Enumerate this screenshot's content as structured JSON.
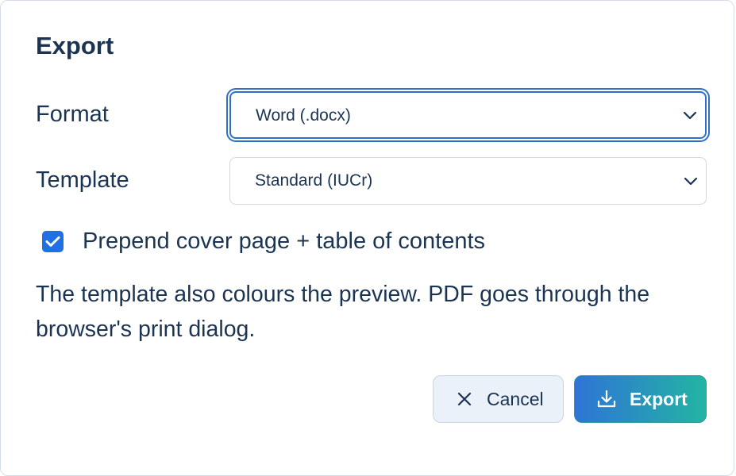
{
  "dialog": {
    "title": "Export",
    "format": {
      "label": "Format",
      "value": "Word (.docx)"
    },
    "template": {
      "label": "Template",
      "value": "Standard (IUCr)"
    },
    "cover_page": {
      "label": "Prepend cover page + table of contents",
      "checked": true
    },
    "note": "The template also colours the preview. PDF goes through the browser's print dialog.",
    "buttons": {
      "cancel_label": "Cancel",
      "export_label": "Export"
    }
  },
  "colors": {
    "text": "#1b3452",
    "accent": "#1f6fe5",
    "focus_ring": "#2f6fc8",
    "export_gradient_start": "#2f74d6",
    "export_gradient_end": "#23b4a3",
    "cancel_bg": "#eaf1f9"
  },
  "icons": {
    "select_chevron": "chevron-down-icon",
    "checkbox": "check-icon",
    "cancel": "close-icon",
    "export": "download-icon"
  }
}
